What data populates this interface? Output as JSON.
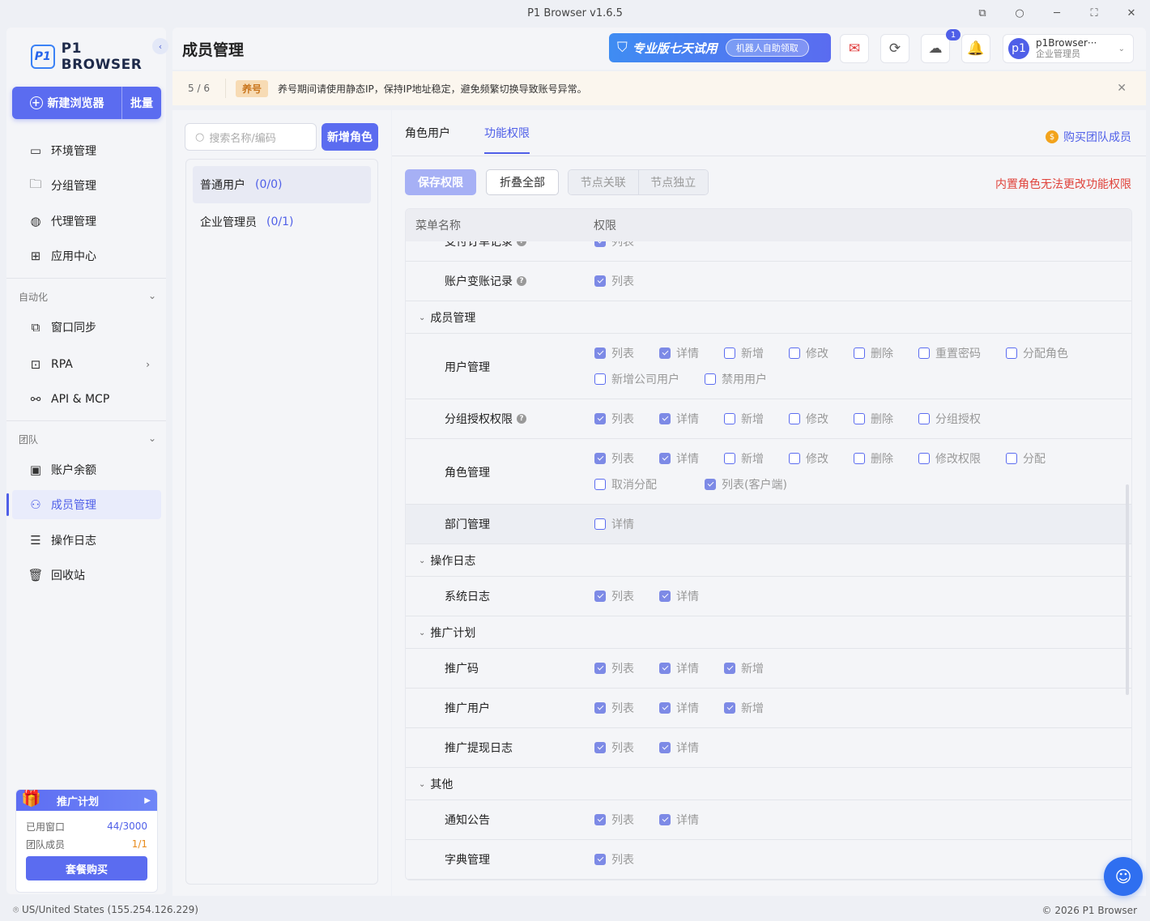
{
  "window": {
    "title": "P1 Browser v1.6.5"
  },
  "sidebar": {
    "logo_mark": "P1",
    "logo_text": "P1 BROWSER",
    "new_browser": "新建浏览器",
    "batch": "批量",
    "items": [
      {
        "label": "环境管理",
        "icon": "window-icon"
      },
      {
        "label": "分组管理",
        "icon": "folder-icon"
      },
      {
        "label": "代理管理",
        "icon": "globe-icon"
      },
      {
        "label": "应用中心",
        "icon": "apps-icon"
      }
    ],
    "automation_label": "自动化",
    "automation_items": [
      {
        "label": "窗口同步",
        "icon": "sync-window-icon"
      },
      {
        "label": "RPA",
        "icon": "robot-icon"
      },
      {
        "label": "API & MCP",
        "icon": "api-icon"
      }
    ],
    "team_label": "团队",
    "team_items": [
      {
        "label": "账户余额",
        "icon": "wallet-icon"
      },
      {
        "label": "成员管理",
        "icon": "members-icon",
        "active": true
      },
      {
        "label": "操作日志",
        "icon": "log-icon"
      },
      {
        "label": "回收站",
        "icon": "trash-icon"
      }
    ],
    "promo": {
      "title": "推广计划",
      "used_windows_label": "已用窗口",
      "used_windows_value": "44/3000",
      "team_members_label": "团队成员",
      "team_members_value": "1/1",
      "buy": "套餐购买"
    }
  },
  "header": {
    "title": "成员管理",
    "trial_text": "专业版七天试用",
    "trial_sub": "机器人自助领取",
    "download_badge": "1",
    "user_name": "p1Browser···",
    "user_role": "企业管理员",
    "avatar": "p1"
  },
  "notice": {
    "page": "5 / 6",
    "tag": "养号",
    "message": "养号期间请使用静态IP，保持IP地址稳定，避免频繁切换导致账号异常。"
  },
  "roles": {
    "search_placeholder": "搜索名称/编码",
    "add_role": "新增角色",
    "list": [
      {
        "name": "普通用户",
        "count": "(0/0)",
        "active": true
      },
      {
        "name": "企业管理员",
        "count": "(0/1)",
        "active": false
      }
    ]
  },
  "perm": {
    "tabs": [
      {
        "label": "角色用户",
        "active": false
      },
      {
        "label": "功能权限",
        "active": true
      }
    ],
    "buy_team": "购买团队成员",
    "save": "保存权限",
    "fold_all": "折叠全部",
    "node_link": "节点关联",
    "node_independent": "节点独立",
    "warning": "内置角色无法更改功能权限",
    "col_menu": "菜单名称",
    "col_perm": "权限",
    "rows": [
      {
        "type": "item",
        "name": "支付订单记录",
        "help": true,
        "perms": [
          {
            "label": "列表",
            "on": true
          }
        ]
      },
      {
        "type": "item",
        "name": "账户变账记录",
        "help": true,
        "perms": [
          {
            "label": "列表",
            "on": true
          }
        ]
      },
      {
        "type": "group",
        "name": "成员管理"
      },
      {
        "type": "item",
        "name": "用户管理",
        "help": false,
        "perms": [
          {
            "label": "列表",
            "on": true
          },
          {
            "label": "详情",
            "on": true
          },
          {
            "label": "新增",
            "on": false
          },
          {
            "label": "修改",
            "on": false
          },
          {
            "label": "删除",
            "on": false
          },
          {
            "label": "重置密码",
            "on": false
          },
          {
            "label": "分配角色",
            "on": false
          },
          {
            "label": "新增公司用户",
            "on": false
          },
          {
            "label": "禁用用户",
            "on": false
          }
        ]
      },
      {
        "type": "item",
        "name": "分组授权权限",
        "help": true,
        "perms": [
          {
            "label": "列表",
            "on": true
          },
          {
            "label": "详情",
            "on": true
          },
          {
            "label": "新增",
            "on": false
          },
          {
            "label": "修改",
            "on": false
          },
          {
            "label": "删除",
            "on": false
          },
          {
            "label": "分组授权",
            "on": false
          }
        ]
      },
      {
        "type": "item",
        "name": "角色管理",
        "help": false,
        "perms": [
          {
            "label": "列表",
            "on": true
          },
          {
            "label": "详情",
            "on": true
          },
          {
            "label": "新增",
            "on": false
          },
          {
            "label": "修改",
            "on": false
          },
          {
            "label": "删除",
            "on": false
          },
          {
            "label": "修改权限",
            "on": false
          },
          {
            "label": "分配",
            "on": false
          },
          {
            "label": "取消分配",
            "on": false
          },
          {
            "label": "列表(客户端)",
            "on": true
          }
        ]
      },
      {
        "type": "item",
        "name": "部门管理",
        "help": false,
        "highlight": true,
        "perms": [
          {
            "label": "详情",
            "on": false
          }
        ]
      },
      {
        "type": "group",
        "name": "操作日志"
      },
      {
        "type": "item",
        "name": "系统日志",
        "help": false,
        "perms": [
          {
            "label": "列表",
            "on": true
          },
          {
            "label": "详情",
            "on": true
          }
        ]
      },
      {
        "type": "group",
        "name": "推广计划"
      },
      {
        "type": "item",
        "name": "推广码",
        "help": false,
        "perms": [
          {
            "label": "列表",
            "on": true
          },
          {
            "label": "详情",
            "on": true
          },
          {
            "label": "新增",
            "on": true
          }
        ]
      },
      {
        "type": "item",
        "name": "推广用户",
        "help": false,
        "perms": [
          {
            "label": "列表",
            "on": true
          },
          {
            "label": "详情",
            "on": true
          },
          {
            "label": "新增",
            "on": true
          }
        ]
      },
      {
        "type": "item",
        "name": "推广提现日志",
        "help": false,
        "perms": [
          {
            "label": "列表",
            "on": true
          },
          {
            "label": "详情",
            "on": true
          }
        ]
      },
      {
        "type": "group",
        "name": "其他"
      },
      {
        "type": "item",
        "name": "通知公告",
        "help": false,
        "perms": [
          {
            "label": "列表",
            "on": true
          },
          {
            "label": "详情",
            "on": true
          }
        ]
      },
      {
        "type": "item",
        "name": "字典管理",
        "help": false,
        "perms": [
          {
            "label": "列表",
            "on": true
          }
        ]
      }
    ]
  },
  "footer": {
    "location": "US/United States (155.254.126.229)",
    "copyright": "© 2026 P1 Browser"
  },
  "colors": {
    "accent": "#5b6cf0",
    "warning": "#e0433b",
    "notice_bg": "#fbf6ee"
  }
}
